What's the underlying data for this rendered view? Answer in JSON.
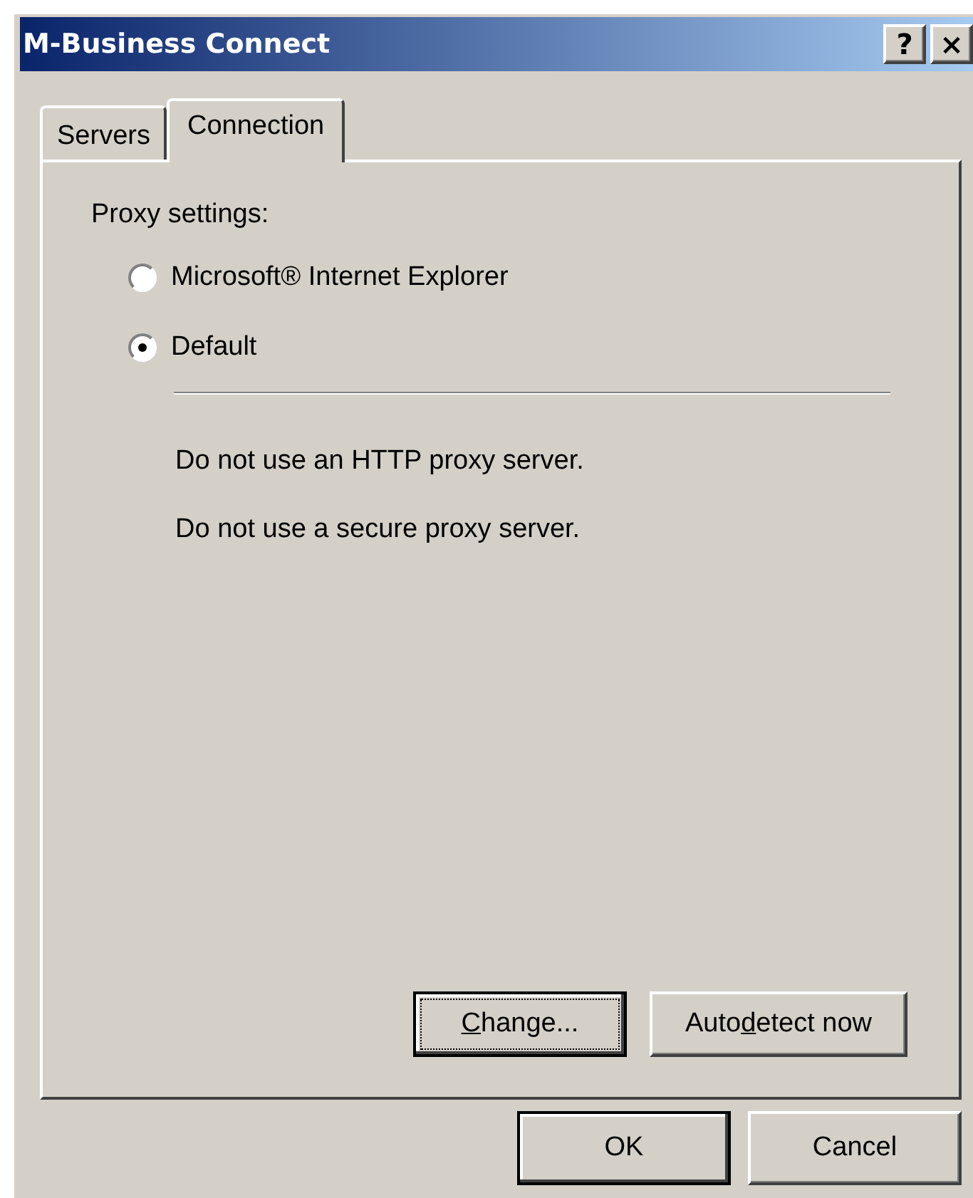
{
  "window": {
    "title": "M-Business Connect",
    "title_buttons": [
      "?",
      "×"
    ]
  },
  "tabs": [
    {
      "label": "Servers",
      "selected": false
    },
    {
      "label": "Connection",
      "selected": true
    }
  ],
  "proxy_settings": {
    "label": "Proxy settings:",
    "options": [
      {
        "label": "Microsoft® Internet Explorer",
        "selected": false
      },
      {
        "label": "Default",
        "selected": true
      }
    ],
    "messages": [
      "Do not use an HTTP proxy server.",
      "Do not use a secure proxy server."
    ]
  },
  "panel_buttons": [
    {
      "parts": [
        {
          "text": "C",
          "underline": true
        },
        {
          "text": "hange...",
          "underline": false
        }
      ],
      "focused": true
    },
    {
      "parts": [
        {
          "text": "Auto",
          "underline": false
        },
        {
          "text": "d",
          "underline": true
        },
        {
          "text": "etect now",
          "underline": false
        }
      ],
      "focused": false
    }
  ],
  "dialog_buttons": [
    {
      "label": "OK",
      "default": true
    },
    {
      "label": "Cancel",
      "default": false
    }
  ]
}
